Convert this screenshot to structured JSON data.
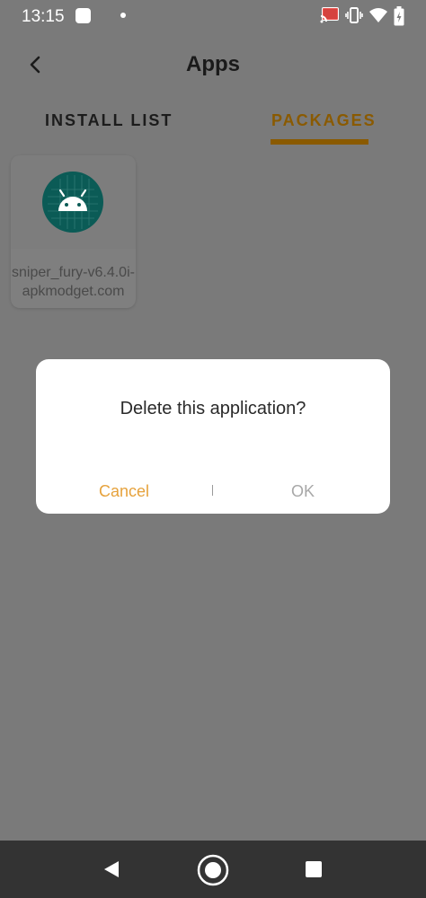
{
  "status_bar": {
    "time": "13:15",
    "icons": [
      "cast-icon",
      "vibrate-icon",
      "wifi-icon",
      "battery-icon"
    ]
  },
  "header": {
    "title": "Apps"
  },
  "tabs": [
    {
      "label": "INSTALL LIST",
      "active": false
    },
    {
      "label": "PACKAGES",
      "active": true
    }
  ],
  "apps": [
    {
      "name_line1": "sniper_fury-v6.4.0i-",
      "name_line2": "apkmodget.com",
      "icon": "android-icon"
    }
  ],
  "dialog": {
    "message": "Delete this application?",
    "cancel_label": "Cancel",
    "ok_label": "OK"
  },
  "nav_bar": {
    "buttons": [
      "back-icon",
      "home-icon",
      "recents-icon"
    ]
  },
  "colors": {
    "accent": "#8a5a00",
    "cancel": "#e6a23c",
    "icon_bg": "#0b5b56"
  }
}
